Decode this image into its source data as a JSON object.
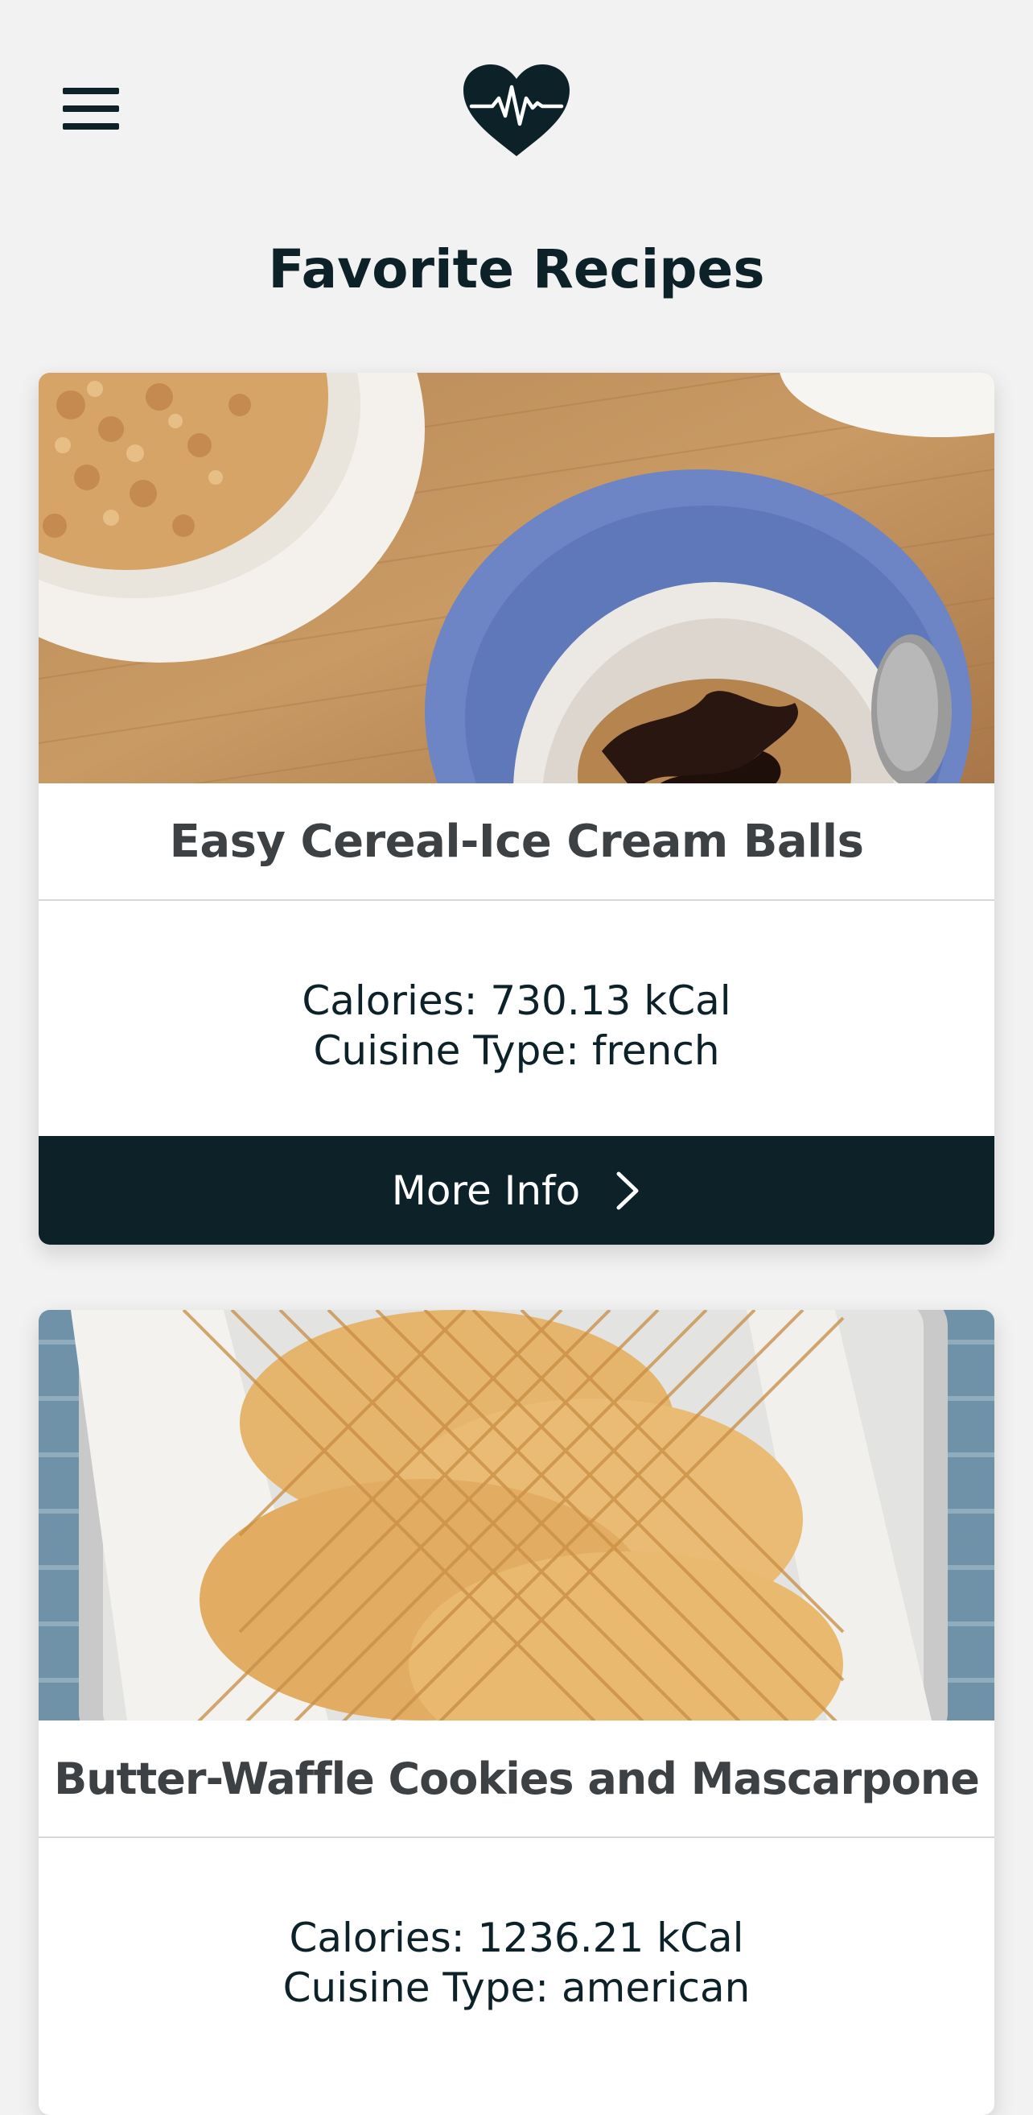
{
  "header": {
    "menu_icon": "hamburger-menu-icon",
    "logo_icon": "heart-pulse-icon"
  },
  "page": {
    "title": "Favorite Recipes"
  },
  "recipes": [
    {
      "title": "Easy Cereal-Ice Cream Balls",
      "calories": "Calories: 730.13 kCal",
      "cuisine": "Cuisine Type: french",
      "button_label": "More Info",
      "button_icon": "chevron-right-icon",
      "image_icon": "recipe-photo"
    },
    {
      "title": "Butter-Waffle Cookies and Mascarpone",
      "calories": "Calories: 1236.21 kCal",
      "cuisine": "Cuisine Type: american",
      "image_icon": "recipe-photo"
    }
  ],
  "colors": {
    "background": "#f2f2f2",
    "primary_dark": "#0d2129",
    "card_title": "#3d4144",
    "card": "#ffffff"
  }
}
